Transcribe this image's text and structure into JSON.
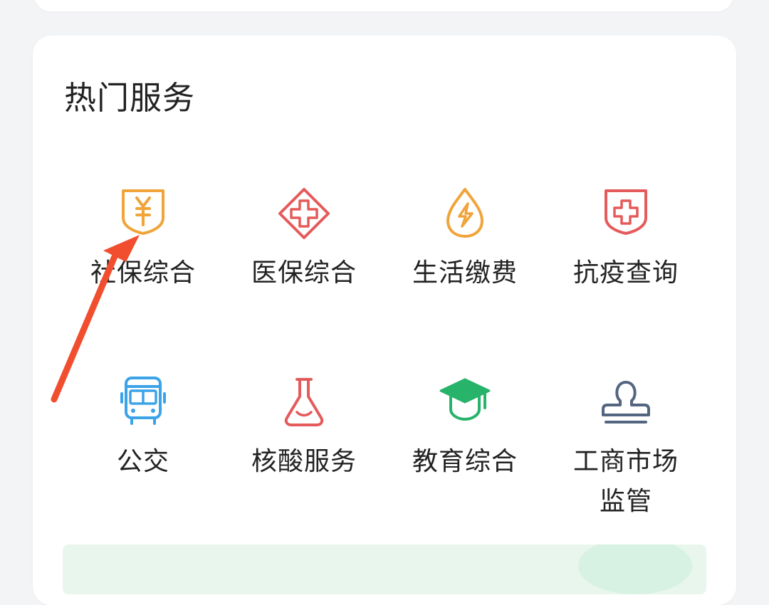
{
  "section": {
    "title": "热门服务"
  },
  "services": [
    {
      "label": "社保综合",
      "icon": "shield-yuan-icon",
      "color": "#F0A43A"
    },
    {
      "label": "医保综合",
      "icon": "medical-diamond-icon",
      "color": "#E55A5A"
    },
    {
      "label": "生活缴费",
      "icon": "lightning-drop-icon",
      "color": "#F0A43A"
    },
    {
      "label": "抗疫查询",
      "icon": "medical-shield-icon",
      "color": "#E55A5A"
    },
    {
      "label": "公交",
      "icon": "bus-icon",
      "color": "#3BA3E8"
    },
    {
      "label": "核酸服务",
      "icon": "flask-icon",
      "color": "#E55A5A"
    },
    {
      "label": "教育综合",
      "icon": "graduation-cap-icon",
      "color": "#27B36A"
    },
    {
      "label": "工商市场监管",
      "icon": "stamp-icon",
      "color": "#53657F"
    }
  ],
  "annotation": {
    "color": "#F04E2F",
    "icon": "arrow-icon"
  }
}
